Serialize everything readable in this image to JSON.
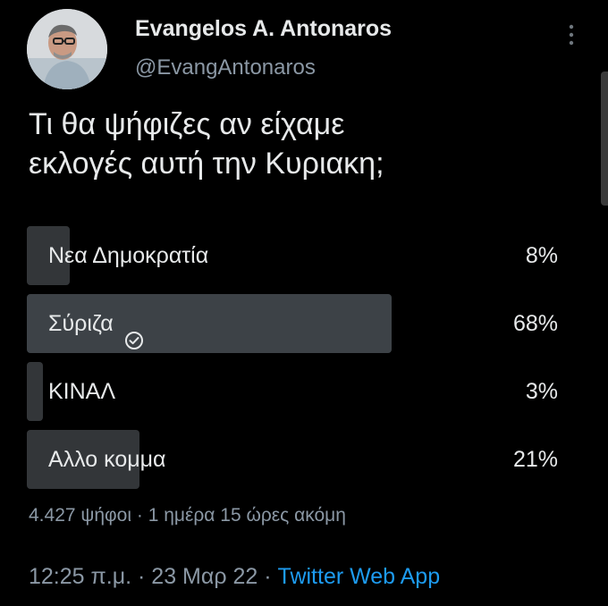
{
  "author": {
    "display_name": "Evangelos A. Antonaros",
    "handle": "@EvangAntonaros",
    "avatar_icon": "profile-photo"
  },
  "tweet": {
    "text_lines": [
      "Τι θα ψήφιζες αν είχαμε",
      "εκλογές αυτή την Κυριακη;"
    ]
  },
  "poll": {
    "options": [
      {
        "label": "Νεα Δημοκρατία",
        "percent": "8%",
        "value": 8
      },
      {
        "label": "Σύριζα",
        "percent": "68%",
        "value": 68,
        "selected": true
      },
      {
        "label": "ΚΙΝΑΛ",
        "percent": "3%",
        "value": 3
      },
      {
        "label": "Αλλο κομμα",
        "percent": "21%",
        "value": 21
      }
    ],
    "votes": "4.427 ψήφοι",
    "separator": "·",
    "time_left": "1 ημέρα 15 ώρες ακόμη"
  },
  "meta": {
    "time": "12:25 π.μ.",
    "separator": "·",
    "date": "23 Μαρ 22",
    "source": "Twitter Web App"
  },
  "colors": {
    "background": "#000000",
    "text": "#e7e9ea",
    "muted": "#8b98a5",
    "poll_bar": "#333639",
    "poll_bar_winner": "#3d4247",
    "link": "#1d9bf0"
  },
  "icons": {
    "more": "more-vertical-icon",
    "selected": "check-circle-icon"
  }
}
